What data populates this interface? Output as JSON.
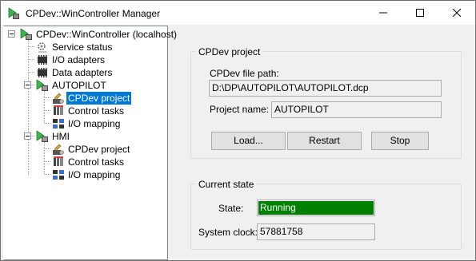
{
  "window": {
    "title": "CPDev::WinController Manager"
  },
  "tree": {
    "root": "CPDev::WinController (localhost)",
    "service_status": "Service status",
    "io_adapters": "I/O adapters",
    "data_adapters": "Data adapters",
    "autopilot": {
      "label": "AUTOPILOT",
      "cpdev_project": "CPDev project",
      "control_tasks": "Control tasks",
      "io_mapping": "I/O mapping"
    },
    "hmi": {
      "label": "HMI",
      "cpdev_project": "CPDev project",
      "control_tasks": "Control tasks",
      "io_mapping": "I/O mapping"
    }
  },
  "project_group": {
    "title": "CPDev project",
    "file_path_label": "CPDev file path:",
    "file_path_value": "D:\\DP\\AUTOPILOT\\AUTOPILOT.dcp",
    "project_name_label": "Project name:",
    "project_name_value": "AUTOPILOT",
    "load_label": "Load...",
    "restart_label": "Restart",
    "stop_label": "Stop"
  },
  "state_group": {
    "title": "Current state",
    "state_label": "State:",
    "state_value": "Running",
    "clock_label": "System clock:",
    "clock_value": "57881758"
  },
  "colors": {
    "selection": "#0078d7",
    "running": "#008000",
    "play_icon": "#3cb44a"
  },
  "icons": {
    "app": "controller-play-icon",
    "service_status": "service-gears-icon",
    "io_adapters": "adapter-chip-icon",
    "data_adapters": "adapter-chip-icon",
    "task": "controller-play-icon",
    "cpdev_project": "project-tools-icon",
    "control_tasks": "task-list-icon",
    "io_mapping": "io-mapping-icon"
  }
}
